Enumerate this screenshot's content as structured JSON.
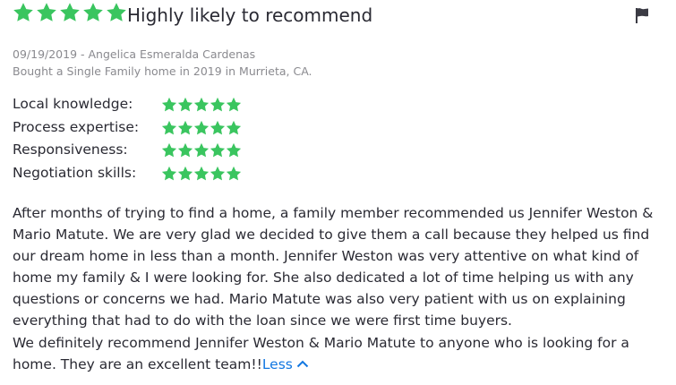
{
  "review": {
    "overall_rating": 5,
    "headline": "Highly likely to recommend",
    "meta": {
      "date_author": "09/19/2019 - Angelica Esmeralda Cardenas",
      "transaction": "Bought a Single Family home in 2019 in Murrieta, CA."
    },
    "sub_ratings": [
      {
        "label": "Local knowledge:",
        "stars": 5
      },
      {
        "label": "Process expertise:",
        "stars": 5
      },
      {
        "label": "Responsiveness:",
        "stars": 5
      },
      {
        "label": "Negotiation skills:",
        "stars": 5
      }
    ],
    "body_lines": [
      "After months of trying to find a home, a family member recommended us Jennifer Weston &",
      "Mario Matute. We are very glad we decided to give them a call because they helped us find",
      "our dream home in less than a month. Jennifer Weston was very attentive on what kind of",
      "home my family & I were looking  for. She also dedicated a lot of time helping us with any",
      "questions or concerns we had. Mario Matute was also very patient with us on explaining",
      "everything that had to do with the loan since we were first time buyers.",
      "We definitely recommend Jennifer Weston & Mario Matute to anyone who is looking for a",
      "home. They are an excellent team!!"
    ],
    "less_label": "Less",
    "star_color": "#3ac55f",
    "link_color": "#1277e1",
    "icons": {
      "star": "star-icon",
      "flag": "flag-icon",
      "chevron": "chevron-up-icon"
    }
  }
}
